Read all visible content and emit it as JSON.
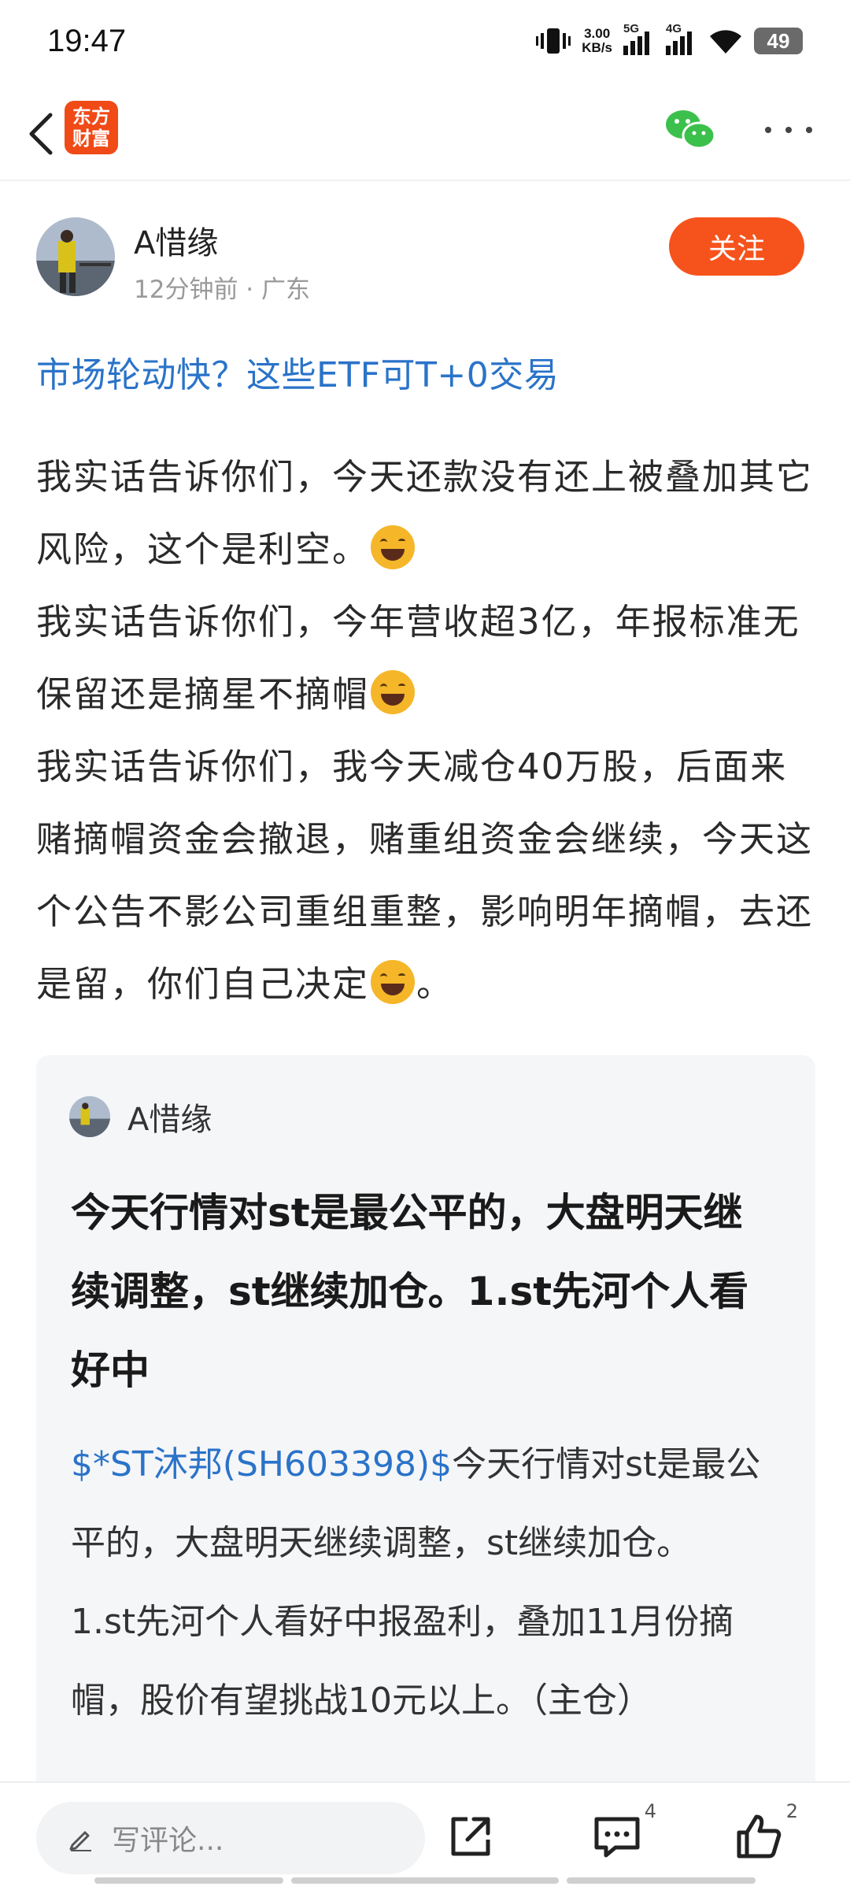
{
  "status_bar": {
    "time": "19:47",
    "net_speed_value": "3.00",
    "net_speed_unit": "KB/s",
    "signal1_label": "5G",
    "signal2_label": "4G",
    "battery": "49"
  },
  "app_bar": {
    "logo_line1": "东方",
    "logo_line2": "财富"
  },
  "author": {
    "name": "A惜缘",
    "meta": "12分钟前 · 广东",
    "follow_label": "关注"
  },
  "post": {
    "title": "市场轮动快？这些ETF可T+0交易",
    "para1": "我实话告诉你们，今天还款没有还上被叠加其它风险，这个是利空。",
    "para2": "我实话告诉你们，今年营收超3亿，年报标准无保留还是摘星不摘帽",
    "para3": "我实话告诉你们，我今天减仓40万股，后面来赌摘帽资金会撤退，赌重组资金会继续，今天这个公告不影公司重组重整，影响明年摘帽，去还是留，你们自己决定",
    "para3_end": "。"
  },
  "quote": {
    "author_name": "A惜缘",
    "title": "今天行情对st是最公平的，大盘明天继续调整，st继续加仓。1.st先河个人看好中",
    "stock_link": "$*ST沐邦(SH603398)$",
    "body1": "今天行情对st是最公平的，大盘明天继续调整，st继续加仓。",
    "body2": "1.st先河个人看好中报盈利，叠加11月份摘帽，股价有望挑战10元以上。（主仓）"
  },
  "bottom_bar": {
    "comment_placeholder": "写评论...",
    "comment_count": "4",
    "like_count": "2"
  },
  "colors": {
    "accent_orange": "#f6531c",
    "link_blue": "#2a73c9",
    "card_bg": "#f5f6f8"
  },
  "icons": [
    "back-arrow-icon",
    "wechat-icon",
    "more-dots-icon",
    "pencil-icon",
    "share-icon",
    "comment-icon",
    "like-icon",
    "laughing-emoji-icon",
    "grin-emoji-icon",
    "smirk-emoji-icon"
  ]
}
